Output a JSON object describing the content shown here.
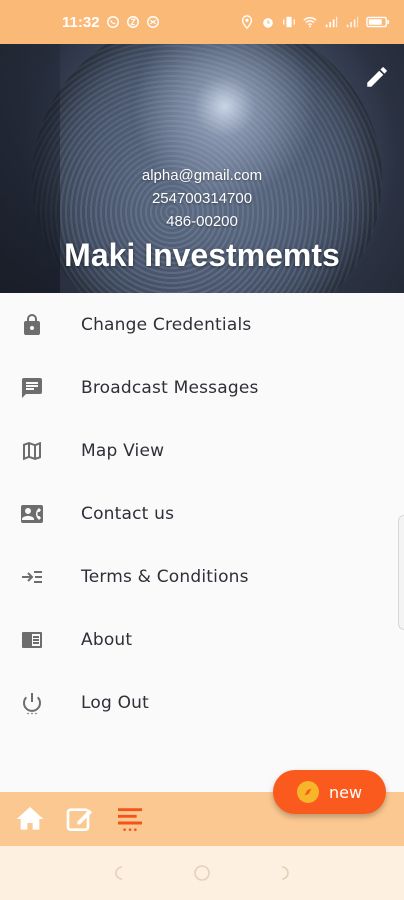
{
  "status_bar": {
    "time": "11:32",
    "icons": [
      "whatsapp-icon",
      "app-icon",
      "app-icon-2",
      "location-icon",
      "alarm-icon",
      "vibrate-icon",
      "wifi-icon",
      "signal-icon",
      "signal-icon-2",
      "battery-icon"
    ],
    "battery": "67"
  },
  "header": {
    "email": "alpha@gmail.com",
    "phone": "254700314700",
    "postal": "486-00200",
    "company": "Maki Investmemts"
  },
  "menu": {
    "items": [
      {
        "label": "Change Credentials",
        "icon": "lock-icon"
      },
      {
        "label": "Broadcast Messages",
        "icon": "message-icon"
      },
      {
        "label": "Map View",
        "icon": "map-icon"
      },
      {
        "label": "Contact us",
        "icon": "contact-card-icon"
      },
      {
        "label": "Terms & Conditions",
        "icon": "terms-icon"
      },
      {
        "label": "About",
        "icon": "about-icon"
      },
      {
        "label": "Log Out",
        "icon": "power-icon"
      }
    ]
  },
  "fab": {
    "label": "new"
  },
  "bottom_nav": {
    "items": [
      "home-icon",
      "edit-icon",
      "menu-lines-icon"
    ],
    "active_color": "#f3541c",
    "color": "#ffffff"
  },
  "colors": {
    "status_bar": "#fbb978",
    "bottom_nav": "#fbc891",
    "fab": "#fb5a1e"
  }
}
